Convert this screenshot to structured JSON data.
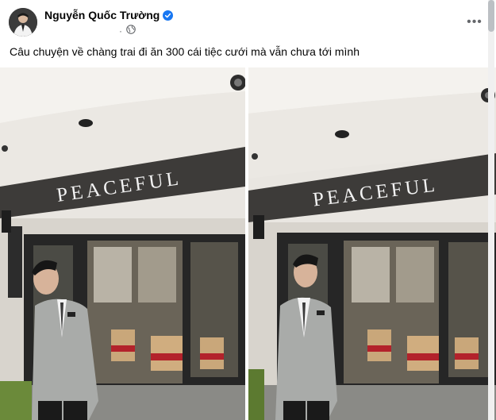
{
  "post": {
    "author": "Nguyễn Quốc Trường",
    "meta_separator": "·",
    "caption": "Câu chuyện về chàng trai đi ăn 300 cái tiệc cưới mà vẫn chưa tới mình",
    "more_label": "•••"
  },
  "photos": [
    {
      "sign_text": "PEACEFUL"
    },
    {
      "sign_text": "PEACEFUL"
    }
  ],
  "icons": {
    "verified": "verified-badge-icon",
    "audience": "globe-icon",
    "more": "more-options-icon"
  },
  "colors": {
    "verified_blue": "#1877f2",
    "meta_gray": "#65676b"
  }
}
